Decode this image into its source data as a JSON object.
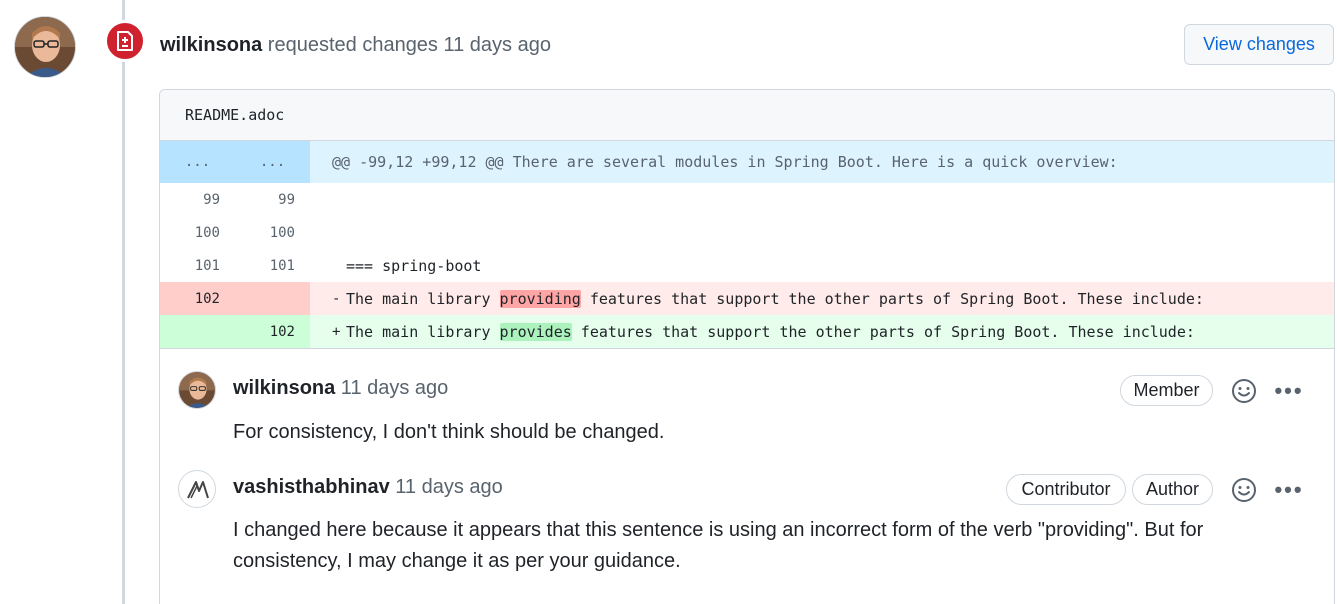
{
  "review": {
    "author": "wilkinsona",
    "action": " requested changes 11 days ago",
    "view_changes_label": "View changes"
  },
  "file": {
    "name": "README.adoc"
  },
  "diff": {
    "hunk": {
      "old_ln": "...",
      "new_ln": "...",
      "text": "@@ -99,12 +99,12 @@ There are several modules in Spring Boot. Here is a quick overview:"
    },
    "context_rows": [
      {
        "old": "99",
        "new": "99",
        "text": ""
      },
      {
        "old": "100",
        "new": "100",
        "text": ""
      },
      {
        "old": "101",
        "new": "101",
        "text": "=== spring-boot"
      }
    ],
    "deleted": {
      "old": "102",
      "sign": "-",
      "before": "The main library ",
      "word": "providing",
      "after": " features that support the other parts of Spring Boot. These include:"
    },
    "added": {
      "new": "102",
      "sign": "+",
      "before": "The main library ",
      "word": "provides",
      "after": " features that support the other parts of Spring Boot. These include:"
    }
  },
  "comments": [
    {
      "author": "wilkinsona",
      "time": " 11 days ago",
      "labels": [
        "Member"
      ],
      "body": "For consistency, I don't think should be changed."
    },
    {
      "author": "vashisthabhinav",
      "time": " 11 days ago",
      "labels": [
        "Contributor",
        "Author"
      ],
      "body": "I changed here because it appears that this sentence is using an incorrect form of the verb \"providing\". But for consistency, I may change it as per your guidance."
    }
  ],
  "more_glyph": "•••",
  "colors": {
    "request_changes": "#cf222e",
    "link": "#0969da",
    "deletion_bg": "#ffebe9",
    "addition_bg": "#e6ffec",
    "hunk_bg": "#ddf4ff"
  }
}
